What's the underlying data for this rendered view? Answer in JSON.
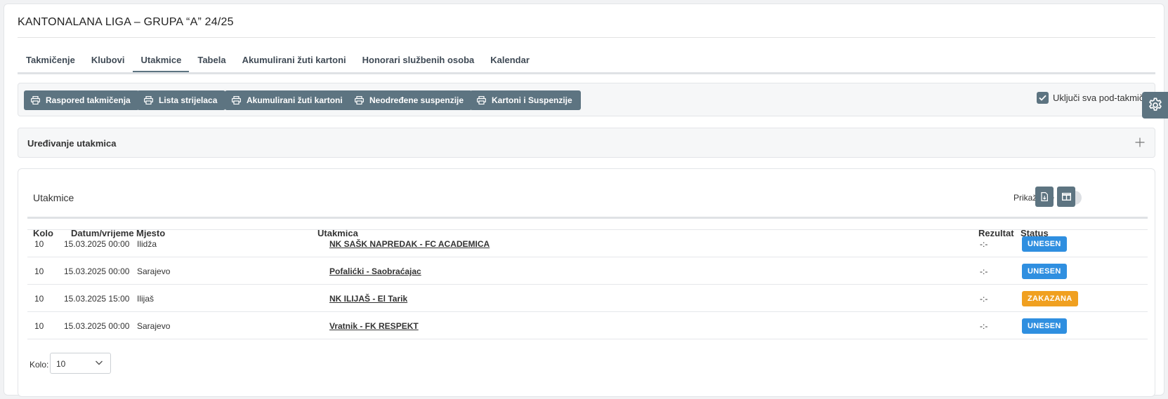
{
  "page": {
    "title": "KANTONALANA LIGA – GRUPA “A” 24/25"
  },
  "tabs": [
    {
      "label": "Takmičenje",
      "active": false
    },
    {
      "label": "Klubovi",
      "active": false
    },
    {
      "label": "Utakmice",
      "active": true
    },
    {
      "label": "Tabela",
      "active": false
    },
    {
      "label": "Akumulirani žuti kartoni",
      "active": false
    },
    {
      "label": "Honorari službenih osoba",
      "active": false
    },
    {
      "label": "Kalendar",
      "active": false
    }
  ],
  "print_buttons": [
    {
      "label": "Raspored takmičenja",
      "icon": "printer-icon"
    },
    {
      "label": "Lista strijelaca",
      "icon": "printer-icon"
    },
    {
      "label": "Akumulirani žuti kartoni",
      "icon": "printer-icon"
    },
    {
      "label": "Neodređene suspenzije",
      "icon": "printer-icon"
    },
    {
      "label": "Kartoni i Suspenzije",
      "icon": "printer-icon"
    }
  ],
  "include_subcompetitions": {
    "label": "Uključi sva pod-takmičenja",
    "checked": true
  },
  "accordion": {
    "title": "Uređivanje utakmica",
    "icon": "plus-icon"
  },
  "matches": {
    "title": "Utakmice",
    "show_all_label": "Prikaži sve",
    "show_all_on": false,
    "columns": [
      "Kolo",
      "Datum/vrijeme",
      "Mjesto",
      "Utakmica",
      "Rezultat",
      "Status"
    ],
    "rows": [
      {
        "kolo": "10",
        "datetime": "15.03.2025 00:00",
        "place": "Ilidža",
        "match": "NK SAŠK NAPREDAK - FC ACADEMICA",
        "result": "-:-",
        "status": "UNESEN",
        "status_color": "#2f8fe0"
      },
      {
        "kolo": "10",
        "datetime": "15.03.2025 00:00",
        "place": "Sarajevo",
        "match": "Pofalićki - Saobraćajac",
        "result": "-:-",
        "status": "UNESEN",
        "status_color": "#2f8fe0"
      },
      {
        "kolo": "10",
        "datetime": "15.03.2025 15:00",
        "place": "Ilijaš",
        "match": "NK ILIJAŠ - El Tarik",
        "result": "-:-",
        "status": "ZAKAZANA",
        "status_color": "#f0a020"
      },
      {
        "kolo": "10",
        "datetime": "15.03.2025 00:00",
        "place": "Sarajevo",
        "match": "Vratnik - FK RESPEKT",
        "result": "-:-",
        "status": "UNESEN",
        "status_color": "#2f8fe0"
      }
    ],
    "kolo_filter": {
      "label": "Kolo:",
      "value": "10"
    }
  },
  "colors": {
    "accent": "#5d7481",
    "badge_blue": "#2f8fe0",
    "badge_orange": "#f0a020"
  }
}
